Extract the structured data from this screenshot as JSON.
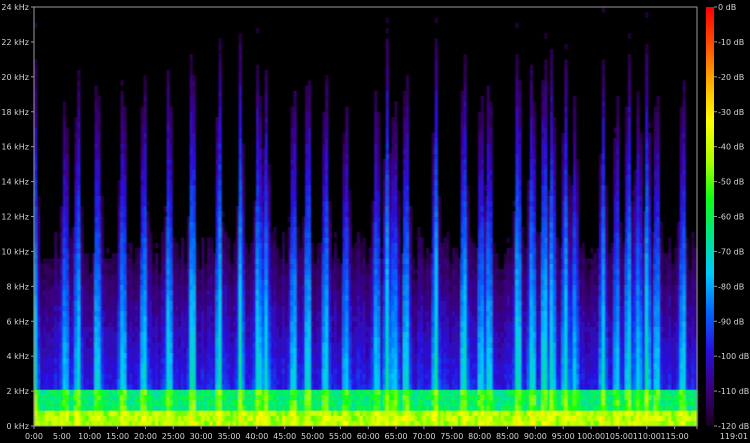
{
  "chart_data": {
    "type": "heatmap",
    "title": "",
    "xlabel": "",
    "ylabel": "",
    "x_unit": "mm:ss",
    "xlim": [
      "0:00",
      "119:01"
    ],
    "ylim_khz": [
      0,
      24
    ],
    "x_ticks": [
      "0:00",
      "5:00",
      "10:00",
      "15:00",
      "20:00",
      "25:00",
      "30:00",
      "35:00",
      "40:00",
      "45:00",
      "50:00",
      "55:00",
      "60:00",
      "65:00",
      "70:00",
      "75:00",
      "80:00",
      "85:00",
      "90:00",
      "95:00",
      "100:00",
      "105:00",
      "110:00",
      "115:00",
      "119:01"
    ],
    "y_ticks": [
      "0 kHz",
      "2 kHz",
      "4 kHz",
      "6 kHz",
      "8 kHz",
      "10 kHz",
      "12 kHz",
      "14 kHz",
      "16 kHz",
      "18 kHz",
      "20 kHz",
      "22 kHz",
      "24 kHz"
    ],
    "colorbar": {
      "range_db": [
        -120,
        0
      ],
      "ticks": [
        "0 dB",
        "-10 dB",
        "-20 dB",
        "-30 dB",
        "-40 dB",
        "-50 dB",
        "-60 dB",
        "-70 dB",
        "-80 dB",
        "-90 dB",
        "-100 dB",
        "-110 dB",
        "-120 dB"
      ],
      "colors": [
        "#1a0022",
        "#3a007a",
        "#2a10e0",
        "#0066ff",
        "#00c8ff",
        "#00e68a",
        "#10ff10",
        "#b0ff00",
        "#ffff00",
        "#ffb000",
        "#ff5000",
        "#ff0000"
      ]
    },
    "colors": {
      "background": "#000000",
      "axis": "#b0b0b0",
      "text": "#d4d4d4"
    },
    "loud_segments_minutes": [
      0.2,
      5.6,
      7.8,
      11.5,
      15.9,
      19.7,
      24.3,
      28.4,
      33.2,
      37.1,
      40.3,
      41.6,
      46.5,
      49.1,
      52.4,
      56.0,
      61.5,
      63.4,
      64.8,
      66.9,
      72.1,
      77.2,
      80.3,
      81.6,
      86.9,
      89.4,
      91.6,
      93.0,
      95.4,
      97.1,
      102.1,
      104.6,
      106.7,
      108.5,
      110.1,
      111.8,
      116.4
    ]
  }
}
